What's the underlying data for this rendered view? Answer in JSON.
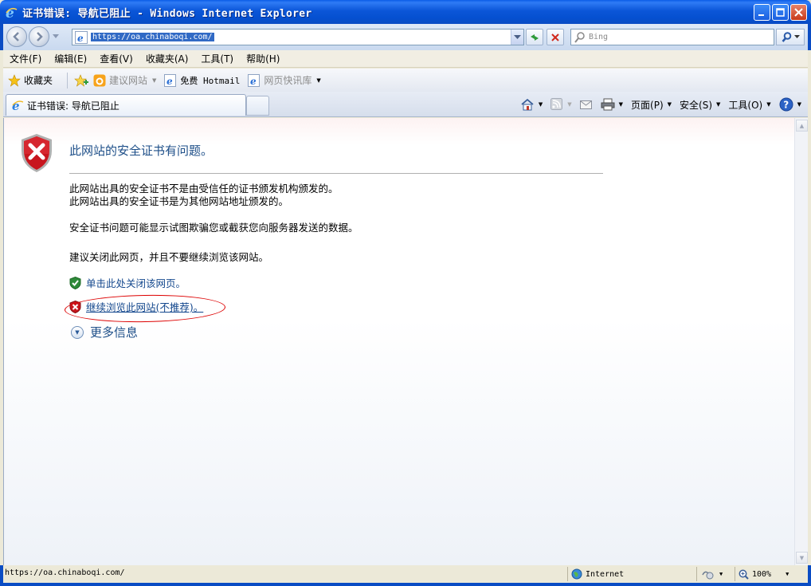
{
  "window": {
    "title": "证书错误: 导航已阻止 - Windows Internet Explorer"
  },
  "nav": {
    "url": "https://oa.chinaboqi.com/",
    "search_placeholder": "Bing"
  },
  "menu": {
    "items": [
      "文件(F)",
      "编辑(E)",
      "查看(V)",
      "收藏夹(A)",
      "工具(T)",
      "帮助(H)"
    ]
  },
  "favorites": {
    "label": "收藏夹",
    "items": [
      "建议网站",
      "免费 Hotmail",
      "网页快讯库"
    ]
  },
  "tab": {
    "title": "证书错误: 导航已阻止"
  },
  "commands": {
    "page": "页面(P)",
    "safety": "安全(S)",
    "tools": "工具(O)"
  },
  "content": {
    "heading": "此网站的安全证书有问题。",
    "para1_line1": "此网站出具的安全证书不是由受信任的证书颁发机构颁发的。",
    "para1_line2": "此网站出具的安全证书是为其他网站地址颁发的。",
    "para2": "安全证书问题可能显示试图欺骗您或截获您向服务器发送的数据。",
    "para3": "建议关闭此网页，并且不要继续浏览该网站。",
    "close_link": "单击此处关闭该网页。",
    "continue_link": "继续浏览此网站(不推荐)。",
    "more_info": "更多信息"
  },
  "status": {
    "url": "https://oa.chinaboqi.com/",
    "zone": "Internet",
    "zoom": "100%"
  },
  "colors": {
    "titlebar": "#0a5ce6",
    "heading": "#1d4e88",
    "link": "#13478d",
    "annotation": "#dd0000"
  }
}
